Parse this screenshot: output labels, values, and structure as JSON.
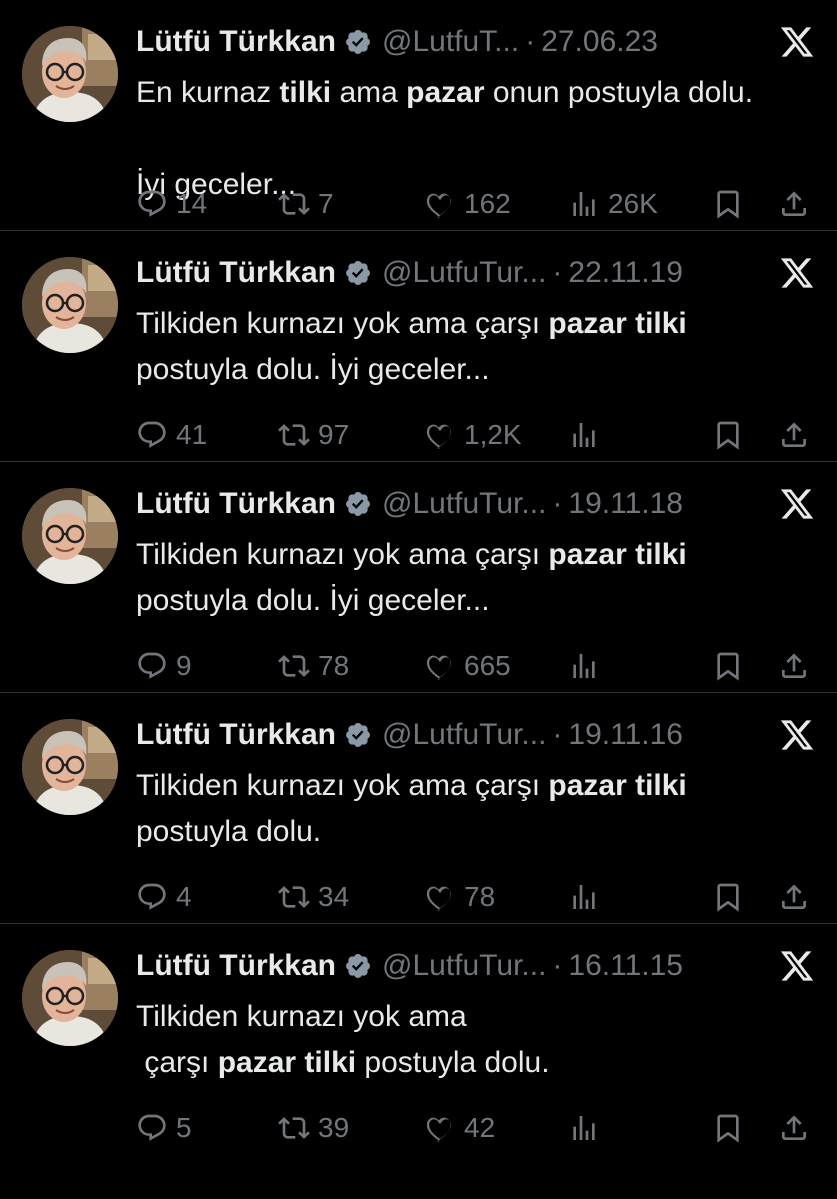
{
  "colors": {
    "background": "#000000",
    "text": "#e7e9ea",
    "muted": "#71767b",
    "verified": "#8b98a5",
    "divider": "#2f3336"
  },
  "icons": {
    "reply": "reply-icon",
    "repost": "repost-icon",
    "like": "heart-icon",
    "views": "views-icon",
    "bookmark": "bookmark-icon",
    "share": "share-icon",
    "brand": "x-logo-icon",
    "verified": "verified-badge-icon"
  },
  "tweets": [
    {
      "name": "Lütfü Türkkan",
      "handle": "@LutfuT...",
      "separator": "·",
      "date": "27.06.23",
      "text": [
        {
          "t": "En kurnaz ",
          "b": false
        },
        {
          "t": "tilki",
          "b": true
        },
        {
          "t": " ama ",
          "b": false
        },
        {
          "t": "pazar",
          "b": true
        },
        {
          "t": " onun postuyla dolu.\n\nİyi geceler...",
          "b": false
        }
      ],
      "replies": "14",
      "reposts": "7",
      "likes": "162",
      "views": "26K"
    },
    {
      "name": "Lütfü Türkkan",
      "handle": "@LutfuTur...",
      "separator": "·",
      "date": "22.11.19",
      "text": [
        {
          "t": "Tilkiden kurnazı yok ama çarşı ",
          "b": false
        },
        {
          "t": "pazar tilki",
          "b": true
        },
        {
          "t": "\npostuyla dolu. İyi geceler...",
          "b": false
        }
      ],
      "replies": "41",
      "reposts": "97",
      "likes": "1,2K",
      "views": ""
    },
    {
      "name": "Lütfü Türkkan",
      "handle": "@LutfuTur...",
      "separator": "·",
      "date": "19.11.18",
      "text": [
        {
          "t": "Tilkiden kurnazı yok ama çarşı ",
          "b": false
        },
        {
          "t": "pazar tilki",
          "b": true
        },
        {
          "t": "\npostuyla dolu. İyi geceler...",
          "b": false
        }
      ],
      "replies": "9",
      "reposts": "78",
      "likes": "665",
      "views": ""
    },
    {
      "name": "Lütfü Türkkan",
      "handle": "@LutfuTur...",
      "separator": "·",
      "date": "19.11.16",
      "text": [
        {
          "t": "Tilkiden kurnazı yok ama çarşı ",
          "b": false
        },
        {
          "t": "pazar tilki",
          "b": true
        },
        {
          "t": "\npostuyla dolu.",
          "b": false
        }
      ],
      "replies": "4",
      "reposts": "34",
      "likes": "78",
      "views": ""
    },
    {
      "name": "Lütfü Türkkan",
      "handle": "@LutfuTur...",
      "separator": "·",
      "date": "16.11.15",
      "text": [
        {
          "t": "Tilkiden kurnazı yok ama\n çarşı ",
          "b": false
        },
        {
          "t": "pazar tilki",
          "b": true
        },
        {
          "t": " postuyla dolu.",
          "b": false
        }
      ],
      "replies": "5",
      "reposts": "39",
      "likes": "42",
      "views": ""
    }
  ]
}
